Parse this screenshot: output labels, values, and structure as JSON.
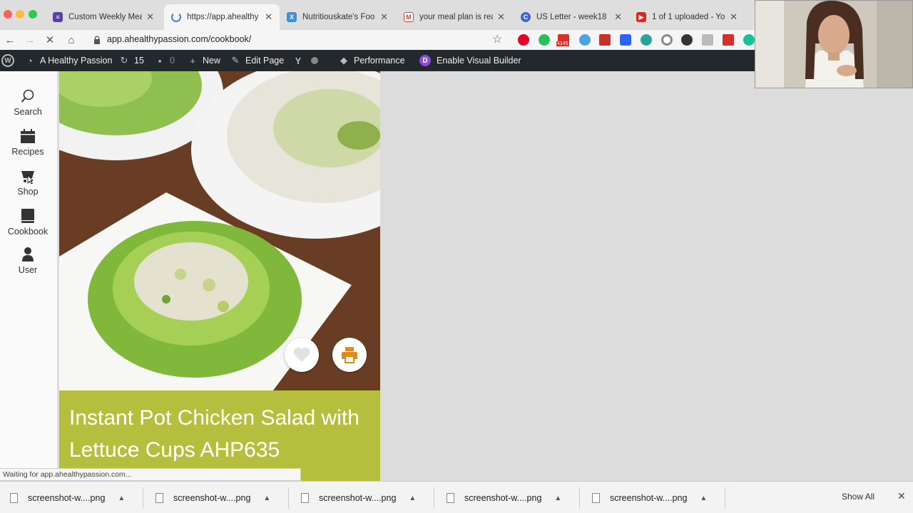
{
  "browser": {
    "tabs": [
      {
        "title": "Custom Weekly Mea",
        "favicon_color": "#5b3fa8",
        "active": false
      },
      {
        "title": "https://app.ahealthy",
        "favicon_color": "#4a7bd8",
        "active": true
      },
      {
        "title": "Nutritiouskate's Foo",
        "favicon_color": "#3b8fd6",
        "active": false
      },
      {
        "title": "your meal plan is rea",
        "favicon_color": "#d44638",
        "active": false
      },
      {
        "title": "US Letter - week18",
        "favicon_color": "#3f64d6",
        "active": false
      },
      {
        "title": "1 of 1 uploaded - Yo",
        "favicon_color": "#e62117",
        "active": false
      }
    ],
    "url": "app.ahealthypassion.com/cookbook/",
    "extension_badge": "4145"
  },
  "adminbar": {
    "site_name": "A Healthy Passion",
    "updates_count": "15",
    "comments_count": "0",
    "new_label": "New",
    "edit_label": "Edit Page",
    "performance_label": "Performance",
    "visual_builder_label": "Enable Visual Builder"
  },
  "sidenav": {
    "items": [
      {
        "label": "Search",
        "icon": "search-icon"
      },
      {
        "label": "Recipes",
        "icon": "calendar-icon"
      },
      {
        "label": "Shop",
        "icon": "cart-icon"
      },
      {
        "label": "Cookbook",
        "icon": "book-icon"
      },
      {
        "label": "User",
        "icon": "user-icon"
      }
    ]
  },
  "recipe": {
    "title": "Instant Pot Chicken Salad with Lettuce Cups AHP635",
    "favorite_icon": "heart-icon",
    "print_icon": "printer-icon",
    "accent_color": "#b6bf3d",
    "print_color": "#e08a1e"
  },
  "status": {
    "text": "Waiting for app.ahealthypassion.com..."
  },
  "downloads": {
    "items": [
      {
        "name": "screenshot-w....png"
      },
      {
        "name": "screenshot-w....png"
      },
      {
        "name": "screenshot-w....png"
      },
      {
        "name": "screenshot-w....png"
      },
      {
        "name": "screenshot-w....png"
      }
    ],
    "show_all_label": "Show All"
  }
}
